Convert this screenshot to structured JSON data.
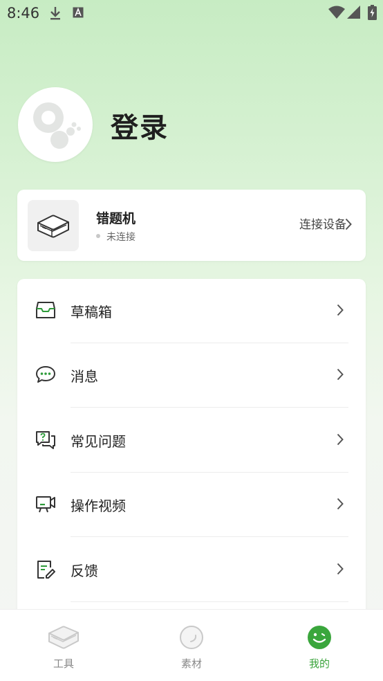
{
  "status_bar": {
    "time": "8:46"
  },
  "profile": {
    "login_label": "登录"
  },
  "device": {
    "name": "错题机",
    "status": "未连接",
    "connect_label": "连接设备"
  },
  "menu": [
    {
      "label": "草稿箱",
      "icon": "inbox-icon"
    },
    {
      "label": "消息",
      "icon": "chat-icon"
    },
    {
      "label": "常见问题",
      "icon": "faq-icon"
    },
    {
      "label": "操作视频",
      "icon": "video-icon"
    },
    {
      "label": "反馈",
      "icon": "feedback-icon"
    }
  ],
  "bottom_nav": [
    {
      "label": "工具",
      "icon": "printer-icon",
      "active": false
    },
    {
      "label": "素材",
      "icon": "material-icon",
      "active": false
    },
    {
      "label": "我的",
      "icon": "smiley-icon",
      "active": true
    }
  ],
  "colors": {
    "accent": "#39a33a",
    "icon_green": "#2e9b3a",
    "bg_top": "#c7ecc3"
  }
}
